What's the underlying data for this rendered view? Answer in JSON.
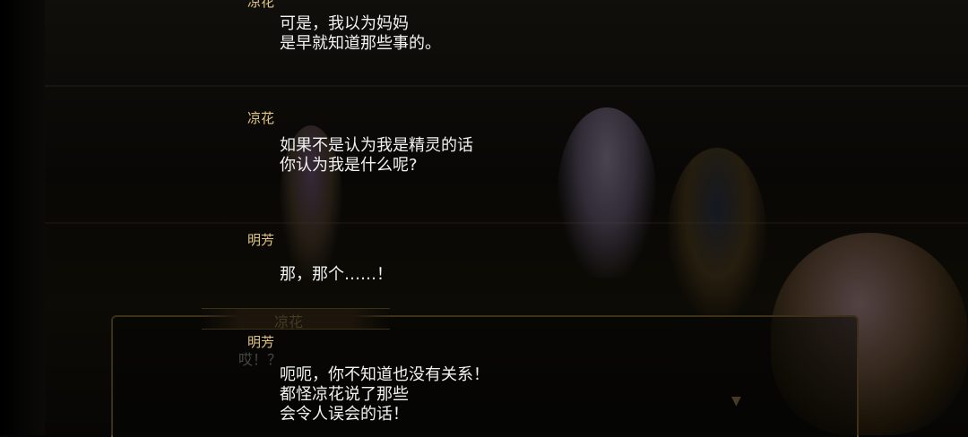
{
  "log": [
    {
      "speaker": "凉花",
      "lines": [
        "可是，我以为妈妈",
        "是早就知道那些事的。"
      ]
    },
    {
      "speaker": "凉花",
      "lines": [
        "如果不是认为我是精灵的话",
        "你认为我是什么呢?"
      ]
    },
    {
      "speaker": "明芳",
      "lines": [
        "那，那个……！"
      ]
    },
    {
      "speaker": "明芳",
      "lines": [
        "呃呃，你不知道也没有关系！",
        "都怪凉花说了那些",
        "会令人误会的话！"
      ]
    }
  ],
  "dialog_box": {
    "name": "凉花",
    "text": "哎！？"
  },
  "colors": {
    "speaker": "#e3c684",
    "text": "#f2f2f2",
    "frame": "#5c4a2a"
  }
}
